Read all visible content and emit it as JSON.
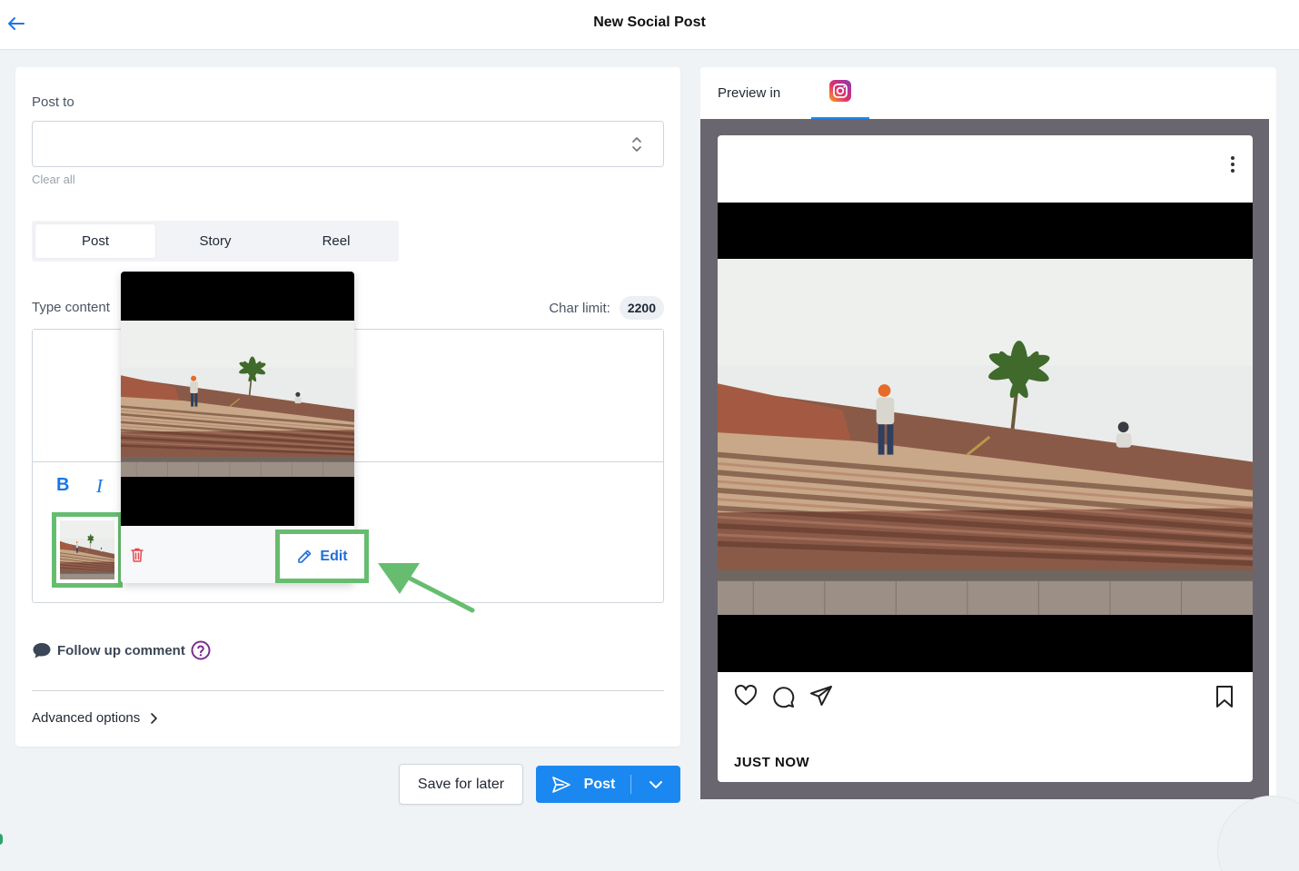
{
  "header": {
    "title": "New Social Post",
    "back_icon": "arrow-left-icon"
  },
  "composer": {
    "post_to_label": "Post to",
    "post_to_value": "",
    "clear_all": "Clear all",
    "tabs": [
      {
        "label": "Post",
        "active": true
      },
      {
        "label": "Story",
        "active": false
      },
      {
        "label": "Reel",
        "active": false
      }
    ],
    "type_content_label": "Type content",
    "char_limit_label": "Char limit:",
    "char_limit_value": "2200",
    "content_value": "",
    "format": {
      "bold": "B",
      "italic": "I"
    },
    "media_popover": {
      "edit_label": "Edit",
      "delete_icon": "trash-icon"
    },
    "follow_up_label": "Follow up comment",
    "advanced_label": "Advanced options"
  },
  "actions": {
    "save_label": "Save for later",
    "post_label": "Post"
  },
  "preview": {
    "label": "Preview in",
    "platform": "instagram",
    "timestamp": "JUST NOW"
  },
  "colors": {
    "accent": "#1a88f0",
    "highlight": "#66bd6f",
    "danger": "#e5484d",
    "follow_up_icon": "#7b2f8e"
  }
}
